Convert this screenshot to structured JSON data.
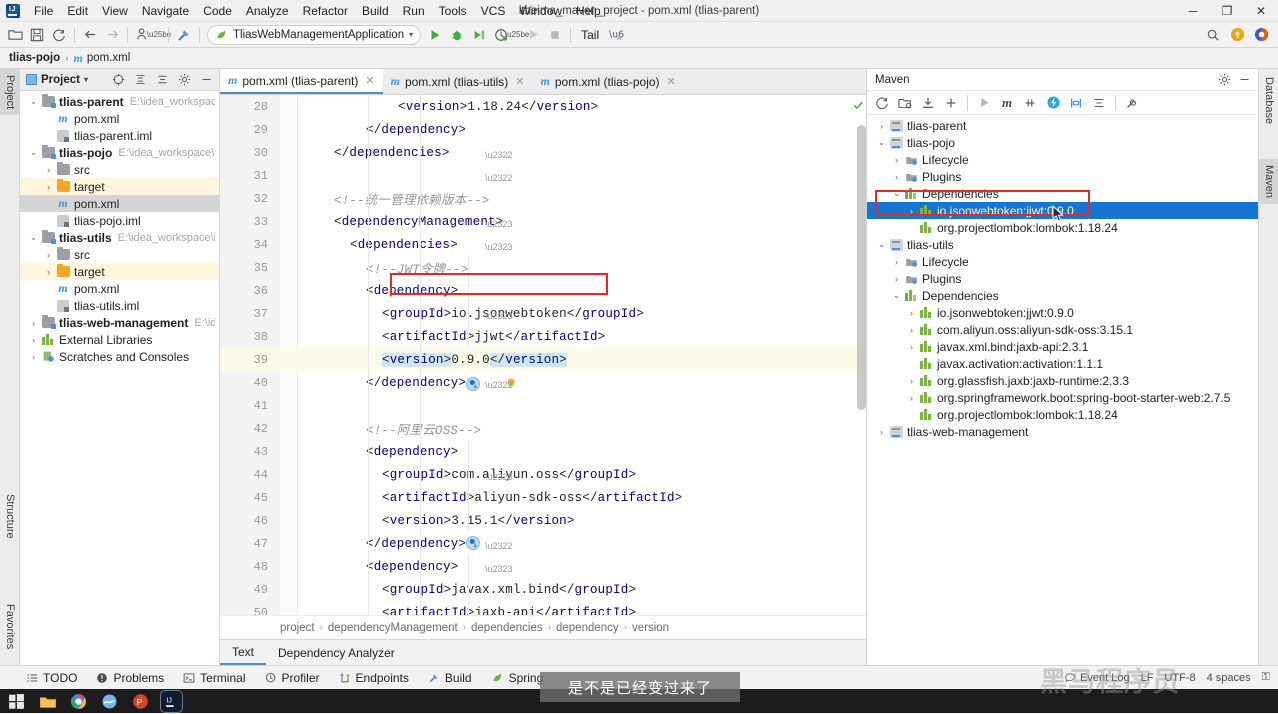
{
  "window": {
    "title": "itheima_maven_project - pom.xml (tlias-parent)",
    "minimize": "─",
    "maximize": "❐",
    "close": "✕"
  },
  "menubar": {
    "items": [
      "File",
      "Edit",
      "View",
      "Navigate",
      "Code",
      "Analyze",
      "Refactor",
      "Build",
      "Run",
      "Tools",
      "VCS",
      "Window",
      "Help"
    ]
  },
  "toolbar": {
    "run_configuration": "TliasWebManagementApplication",
    "dropdown_caret": "▾",
    "tail_label": "Tail"
  },
  "navbar": {
    "module": "tlias-pojo",
    "file": "pom.xml",
    "separator": "›"
  },
  "left_tool_tabs": [
    "Project",
    "Structure",
    "Favorites"
  ],
  "right_tool_tabs": [
    "Database",
    "Maven"
  ],
  "project": {
    "title": "Project",
    "caret": "▾",
    "tree": [
      {
        "depth": 0,
        "arrow": "⌄",
        "icon": "module-folder",
        "label": "tlias-parent",
        "bold": true,
        "path": "E:\\idea_workspace\\ithei",
        "state": "normal"
      },
      {
        "depth": 1,
        "arrow": "",
        "icon": "maven-file",
        "label": "pom.xml",
        "bold": false,
        "path": "",
        "state": "normal"
      },
      {
        "depth": 1,
        "arrow": "",
        "icon": "iml-file",
        "label": "tlias-parent.iml",
        "bold": false,
        "path": "",
        "state": "normal"
      },
      {
        "depth": 0,
        "arrow": "⌄",
        "icon": "module-folder",
        "label": "tlias-pojo",
        "bold": true,
        "path": "E:\\idea_workspace\\ithein",
        "state": "normal"
      },
      {
        "depth": 1,
        "arrow": "›",
        "icon": "folder-gray",
        "label": "src",
        "bold": false,
        "path": "",
        "state": "normal"
      },
      {
        "depth": 1,
        "arrow": "›",
        "icon": "folder-orange",
        "label": "target",
        "bold": false,
        "path": "",
        "state": "highlight"
      },
      {
        "depth": 1,
        "arrow": "",
        "icon": "maven-file",
        "label": "pom.xml",
        "bold": false,
        "path": "",
        "state": "selected"
      },
      {
        "depth": 1,
        "arrow": "",
        "icon": "iml-file",
        "label": "tlias-pojo.iml",
        "bold": false,
        "path": "",
        "state": "normal"
      },
      {
        "depth": 0,
        "arrow": "⌄",
        "icon": "module-folder",
        "label": "tlias-utils",
        "bold": true,
        "path": "E:\\idea_workspace\\ithein",
        "state": "normal"
      },
      {
        "depth": 1,
        "arrow": "›",
        "icon": "folder-gray",
        "label": "src",
        "bold": false,
        "path": "",
        "state": "normal"
      },
      {
        "depth": 1,
        "arrow": "›",
        "icon": "folder-orange",
        "label": "target",
        "bold": false,
        "path": "",
        "state": "highlight"
      },
      {
        "depth": 1,
        "arrow": "",
        "icon": "maven-file",
        "label": "pom.xml",
        "bold": false,
        "path": "",
        "state": "normal"
      },
      {
        "depth": 1,
        "arrow": "",
        "icon": "iml-file",
        "label": "tlias-utils.iml",
        "bold": false,
        "path": "",
        "state": "normal"
      },
      {
        "depth": 0,
        "arrow": "›",
        "icon": "module-folder",
        "label": "tlias-web-management",
        "bold": true,
        "path": "E:\\idea_w",
        "state": "normal"
      },
      {
        "depth": 0,
        "arrow": "›",
        "icon": "library",
        "label": "External Libraries",
        "bold": false,
        "path": "",
        "state": "normal"
      },
      {
        "depth": 0,
        "arrow": "›",
        "icon": "scratches",
        "label": "Scratches and Consoles",
        "bold": false,
        "path": "",
        "state": "normal"
      }
    ]
  },
  "editor": {
    "tabs": [
      {
        "label": "pom.xml (tlias-parent)",
        "active": true,
        "close": "✕"
      },
      {
        "label": "pom.xml (tlias-utils)",
        "active": false,
        "close": "✕"
      },
      {
        "label": "pom.xml (tlias-pojo)",
        "active": false,
        "close": "✕"
      }
    ],
    "first_line_number": 28,
    "current_line": 39,
    "lines": [
      {
        "n": 28,
        "indent": 6,
        "html": "&lt;<span class='tag'>version</span>&gt;1.18.24&lt;/<span class='tag'>version</span>&gt;"
      },
      {
        "n": 29,
        "indent": 4,
        "html": "&lt;/<span class='tag'>dependency</span>&gt;"
      },
      {
        "n": 30,
        "indent": 2,
        "html": "&lt;/<span class='tag'>dependencies</span>&gt;"
      },
      {
        "n": 31,
        "indent": 0,
        "html": ""
      },
      {
        "n": 32,
        "indent": 2,
        "html": "<span class='cmt'>&lt;!--统一管理依赖版本--&gt;</span>"
      },
      {
        "n": 33,
        "indent": 2,
        "html": "&lt;<span class='tag'>dependencyManagement</span>&gt;"
      },
      {
        "n": 34,
        "indent": 3,
        "html": "&lt;<span class='tag'>dependencies</span>&gt;"
      },
      {
        "n": 35,
        "indent": 4,
        "html": "<span class='cmt'>&lt;!--JWT令牌--&gt;</span>"
      },
      {
        "n": 36,
        "indent": 4,
        "html": "&lt;<span class='tag'>dependency</span>&gt;"
      },
      {
        "n": 37,
        "indent": 5,
        "html": "&lt;<span class='tag'>groupId</span>&gt;io.jsonwebtoken&lt;/<span class='tag'>groupId</span>&gt;"
      },
      {
        "n": 38,
        "indent": 5,
        "html": "&lt;<span class='tag'>artifactId</span>&gt;jjwt&lt;/<span class='tag'>artifactId</span>&gt;"
      },
      {
        "n": 39,
        "indent": 5,
        "html": "<span class='hlsel'>&lt;<span class='tag'>version</span>&gt;</span>0.9.0<span class='hlsel'>&lt;/<span class='tag'>version</span>&gt;</span>"
      },
      {
        "n": 40,
        "indent": 4,
        "html": "&lt;/<span class='tag'>dependency</span>&gt;"
      },
      {
        "n": 41,
        "indent": 0,
        "html": ""
      },
      {
        "n": 42,
        "indent": 4,
        "html": "<span class='cmt'>&lt;!--阿里云OSS--&gt;</span>"
      },
      {
        "n": 43,
        "indent": 4,
        "html": "&lt;<span class='tag'>dependency</span>&gt;"
      },
      {
        "n": 44,
        "indent": 5,
        "html": "&lt;<span class='tag'>groupId</span>&gt;com.aliyun.oss&lt;/<span class='tag'>groupId</span>&gt;"
      },
      {
        "n": 45,
        "indent": 5,
        "html": "&lt;<span class='tag'>artifactId</span>&gt;aliyun-sdk-oss&lt;/<span class='tag'>artifactId</span>&gt;"
      },
      {
        "n": 46,
        "indent": 5,
        "html": "&lt;<span class='tag'>version</span>&gt;3.15.1&lt;/<span class='tag'>version</span>&gt;"
      },
      {
        "n": 47,
        "indent": 4,
        "html": "&lt;/<span class='tag'>dependency</span>&gt;"
      },
      {
        "n": 48,
        "indent": 4,
        "html": "&lt;<span class='tag'>dependency</span>&gt;"
      },
      {
        "n": 49,
        "indent": 5,
        "html": "&lt;<span class='tag'>groupId</span>&gt;javax.xml.bind&lt;/<span class='tag'>groupId</span>&gt;"
      },
      {
        "n": 50,
        "indent": 5,
        "html": "&lt;<span class='tag'>artifactId</span>&gt;jaxb-api&lt;/<span class='tag'>artifactId</span>&gt;"
      }
    ],
    "breadcrumb": [
      "project",
      "dependencyManagement",
      "dependencies",
      "dependency",
      "version"
    ],
    "breadcrumb_separator": "›",
    "bottom_tabs": [
      {
        "label": "Text",
        "active": true
      },
      {
        "label": "Dependency Analyzer",
        "active": false
      }
    ]
  },
  "maven": {
    "title": "Maven",
    "tree": [
      {
        "depth": 0,
        "arrow": "›",
        "icon": "maven-module",
        "label": "tlias-parent",
        "selected": false
      },
      {
        "depth": 0,
        "arrow": "⌄",
        "icon": "maven-module",
        "label": "tlias-pojo",
        "selected": false
      },
      {
        "depth": 1,
        "arrow": "›",
        "icon": "phase-folder",
        "label": "Lifecycle",
        "selected": false
      },
      {
        "depth": 1,
        "arrow": "›",
        "icon": "phase-folder",
        "label": "Plugins",
        "selected": false
      },
      {
        "depth": 1,
        "arrow": "⌄",
        "icon": "deps-folder",
        "label": "Dependencies",
        "selected": false
      },
      {
        "depth": 2,
        "arrow": "›",
        "icon": "library",
        "label": "io.jsonwebtoken:jjwt:0.9.0",
        "selected": true
      },
      {
        "depth": 2,
        "arrow": "",
        "icon": "library",
        "label": "org.projectlombok:lombok:1.18.24",
        "selected": false
      },
      {
        "depth": 0,
        "arrow": "⌄",
        "icon": "maven-module",
        "label": "tlias-utils",
        "selected": false
      },
      {
        "depth": 1,
        "arrow": "›",
        "icon": "phase-folder",
        "label": "Lifecycle",
        "selected": false
      },
      {
        "depth": 1,
        "arrow": "›",
        "icon": "phase-folder",
        "label": "Plugins",
        "selected": false
      },
      {
        "depth": 1,
        "arrow": "⌄",
        "icon": "deps-folder",
        "label": "Dependencies",
        "selected": false
      },
      {
        "depth": 2,
        "arrow": "›",
        "icon": "library",
        "label": "io.jsonwebtoken:jjwt:0.9.0",
        "selected": false
      },
      {
        "depth": 2,
        "arrow": "›",
        "icon": "library",
        "label": "com.aliyun.oss:aliyun-sdk-oss:3.15.1",
        "selected": false
      },
      {
        "depth": 2,
        "arrow": "›",
        "icon": "library",
        "label": "javax.xml.bind:jaxb-api:2.3.1",
        "selected": false
      },
      {
        "depth": 2,
        "arrow": "",
        "icon": "library",
        "label": "javax.activation:activation:1.1.1",
        "selected": false
      },
      {
        "depth": 2,
        "arrow": "›",
        "icon": "library",
        "label": "org.glassfish.jaxb:jaxb-runtime:2.3.3",
        "selected": false
      },
      {
        "depth": 2,
        "arrow": "›",
        "icon": "library",
        "label": "org.springframework.boot:spring-boot-starter-web:2.7.5",
        "selected": false
      },
      {
        "depth": 2,
        "arrow": "",
        "icon": "library",
        "label": "org.projectlombok:lombok:1.18.24",
        "selected": false
      },
      {
        "depth": 0,
        "arrow": "›",
        "icon": "maven-module",
        "label": "tlias-web-management",
        "selected": false
      }
    ]
  },
  "bottom_tool_buttons": [
    {
      "label": "TODO",
      "icon": "todo-icon"
    },
    {
      "label": "Problems",
      "icon": "problems-icon"
    },
    {
      "label": "Terminal",
      "icon": "terminal-icon"
    },
    {
      "label": "Profiler",
      "icon": "profiler-icon"
    },
    {
      "label": "Endpoints",
      "icon": "endpoints-icon"
    },
    {
      "label": "Build",
      "icon": "build-icon"
    },
    {
      "label": "Spring",
      "icon": "spring-icon"
    }
  ],
  "status_bar": {
    "event_log": "Event Log",
    "line_ending": "LF",
    "encoding": "UTF-8",
    "indent": "4 spaces",
    "lock": "⚿"
  },
  "overlay": {
    "caption": "是不是已经变过来了",
    "watermark": "黑马程序员"
  },
  "colors": {
    "accent": "#4a90d9",
    "selection": "#1675d1",
    "highlight_box": "#e32b21",
    "tag": "#000080",
    "comment": "#969696"
  }
}
